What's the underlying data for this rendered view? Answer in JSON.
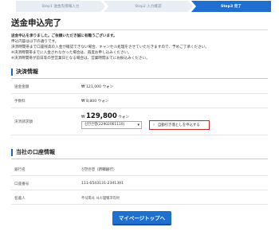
{
  "steps": [
    {
      "label": "Step1  送金先情報入力"
    },
    {
      "label": "Step2  入力確認"
    },
    {
      "label": "Step3  完了"
    }
  ],
  "page_title": "送金申込完了",
  "intro": {
    "line1": "送金申込を承りました。ご依頼いただき誠に有難うございます。",
    "line2": "申込内容は以下の通りです。",
    "line3": "決済時間帯まで口座残高の入金が確認できない場合、キャンセル処理をさせていただきますので、予めご了承ください。",
    "line4": "※決済時間帯までに入金されなかった場合は、再度お申し込みください。",
    "line5": "※決済時間帯が前日等の翌営業日となる場合は、営業時間までにお振込みください。"
  },
  "payment_section": {
    "title": "決済情報",
    "rows": {
      "send_amount": {
        "label": "送金金額",
        "value": "₩ 121,000 ウォン"
      },
      "fee": {
        "label": "手数料",
        "value": "₩ 8,800 ウォン"
      },
      "payment_account": {
        "label": "決済請求額",
        "currency": "₩",
        "amount": "129,800",
        "unit": "ウォン"
      }
    },
    "account_select": {
      "value": "신한은행(22902061110)"
    },
    "auto_setting_button": "自動引き落としを申込する"
  },
  "bank_section": {
    "title": "当社の口座情報",
    "rows": {
      "bank_name": {
        "label": "銀行名",
        "value": "신한은행（新韓銀行）"
      },
      "account_number": {
        "label": "口座番号",
        "value": "111-6543131-2341391"
      },
      "account_holder": {
        "label": "名義人",
        "value": "주식회사 시스템웨코리아"
      }
    }
  },
  "mypage_button": "マイページトップへ",
  "colors": {
    "accent": "#1e6fd0",
    "step_active": "#1e6fd0",
    "step_inactive": "#e9eef4",
    "highlight_border": "#d32020"
  }
}
